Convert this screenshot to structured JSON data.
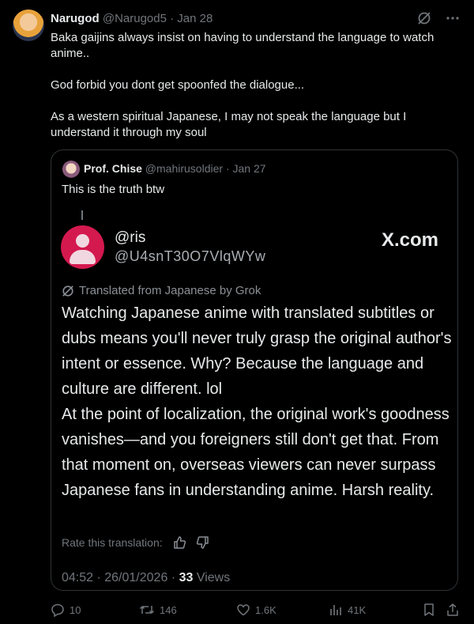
{
  "tweet": {
    "author_name": "Narugod",
    "handle": "@Narugod5",
    "date": "Jan 28",
    "separator": "·",
    "text_lines": [
      "Baka gaijins always insist on having to understand the language to watch anime..",
      "God forbid you dont get spoonfed the dialogue...",
      "As a western spiritual Japanese, I may not speak the language but I understand it through my soul"
    ]
  },
  "quote": {
    "author_name": "Prof. Chise",
    "handle": "@mahirusoldier",
    "date": "Jan 27",
    "text": "This is the truth btw",
    "embedded": {
      "name": "@ris",
      "handle": "@U4snT30O7VlqWYw",
      "brand": "X.com",
      "translated_label": "Translated from Japanese by Grok",
      "body_lines": [
        "Watching Japanese anime with translated subtitles or dubs means you'll never truly grasp the original author's intent or essence. Why? Because the language and culture are different. lol",
        "At the point of localization, the original work's goodness vanishes—and you foreigners still don't get that. From that moment on, overseas viewers can never surpass Japanese fans in understanding anime. Harsh reality."
      ],
      "rate_label": "Rate this translation:",
      "timestamp": "04:52 · 26/01/2026 ·",
      "views_count": "33",
      "views_label": "Views"
    }
  },
  "actions": {
    "replies": "10",
    "reposts": "146",
    "likes": "1.6K",
    "views": "41K"
  },
  "icons": [
    "grok-icon",
    "more-icon",
    "reply-icon",
    "repost-icon",
    "like-icon",
    "views-icon",
    "bookmark-icon",
    "share-icon",
    "thumbs-up-icon",
    "thumbs-down-icon"
  ]
}
